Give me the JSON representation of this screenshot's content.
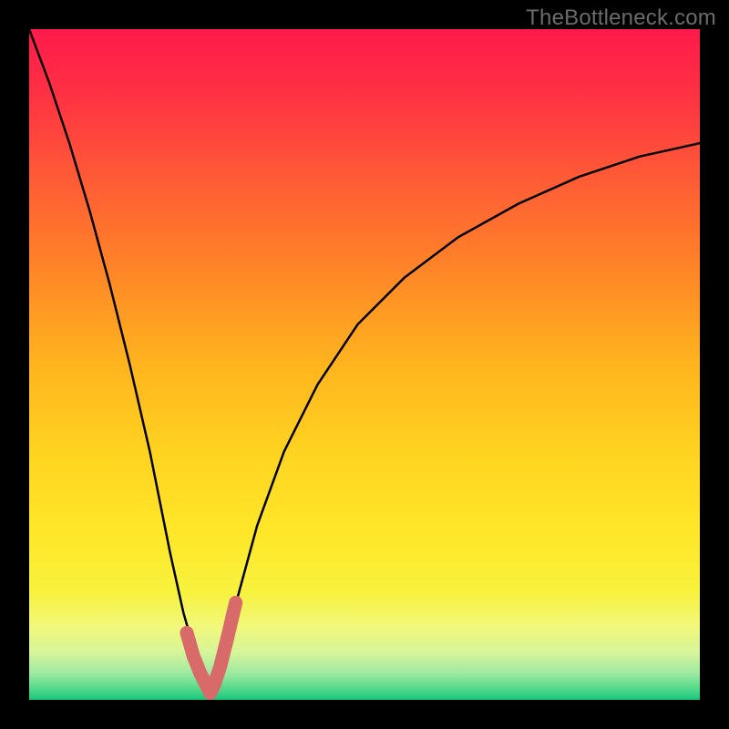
{
  "watermark": "TheBottleneck.com",
  "chart_data": {
    "type": "line",
    "title": "",
    "xlabel": "",
    "ylabel": "",
    "xlim": [
      0,
      100
    ],
    "ylim": [
      0,
      100
    ],
    "optimum_x": 27,
    "series": [
      {
        "name": "bottleneck-curve",
        "x": [
          0,
          3,
          6,
          9,
          12,
          15,
          18,
          21,
          23,
          25,
          26.5,
          27,
          27.5,
          29,
          31,
          34,
          38,
          43,
          49,
          56,
          64,
          73,
          82,
          91,
          100
        ],
        "values": [
          100,
          92,
          83,
          73,
          62,
          50,
          37,
          22,
          13,
          6,
          2,
          1,
          2,
          7,
          15,
          26,
          37,
          47,
          56,
          63,
          69,
          74,
          78,
          81,
          83
        ]
      },
      {
        "name": "good-range-highlight",
        "x": [
          23.5,
          24.5,
          25.5,
          26.5,
          27,
          27.5,
          28.5,
          29.5,
          30.8
        ],
        "values": [
          10.0,
          6.5,
          4.0,
          2.0,
          1.0,
          2.0,
          5.0,
          9.0,
          14.5
        ]
      }
    ],
    "gradient_stops": [
      {
        "offset": 0.0,
        "color": "#ff1a4b"
      },
      {
        "offset": 0.09,
        "color": "#ff2f44"
      },
      {
        "offset": 0.22,
        "color": "#ff5a36"
      },
      {
        "offset": 0.35,
        "color": "#ff8228"
      },
      {
        "offset": 0.5,
        "color": "#ffb41e"
      },
      {
        "offset": 0.63,
        "color": "#ffd321"
      },
      {
        "offset": 0.75,
        "color": "#ffe728"
      },
      {
        "offset": 0.84,
        "color": "#f7f23e"
      },
      {
        "offset": 0.89,
        "color": "#f2f87a"
      },
      {
        "offset": 0.93,
        "color": "#d6f59a"
      },
      {
        "offset": 0.96,
        "color": "#9fe9a1"
      },
      {
        "offset": 0.985,
        "color": "#4fd889"
      },
      {
        "offset": 1.0,
        "color": "#18c67d"
      }
    ]
  }
}
